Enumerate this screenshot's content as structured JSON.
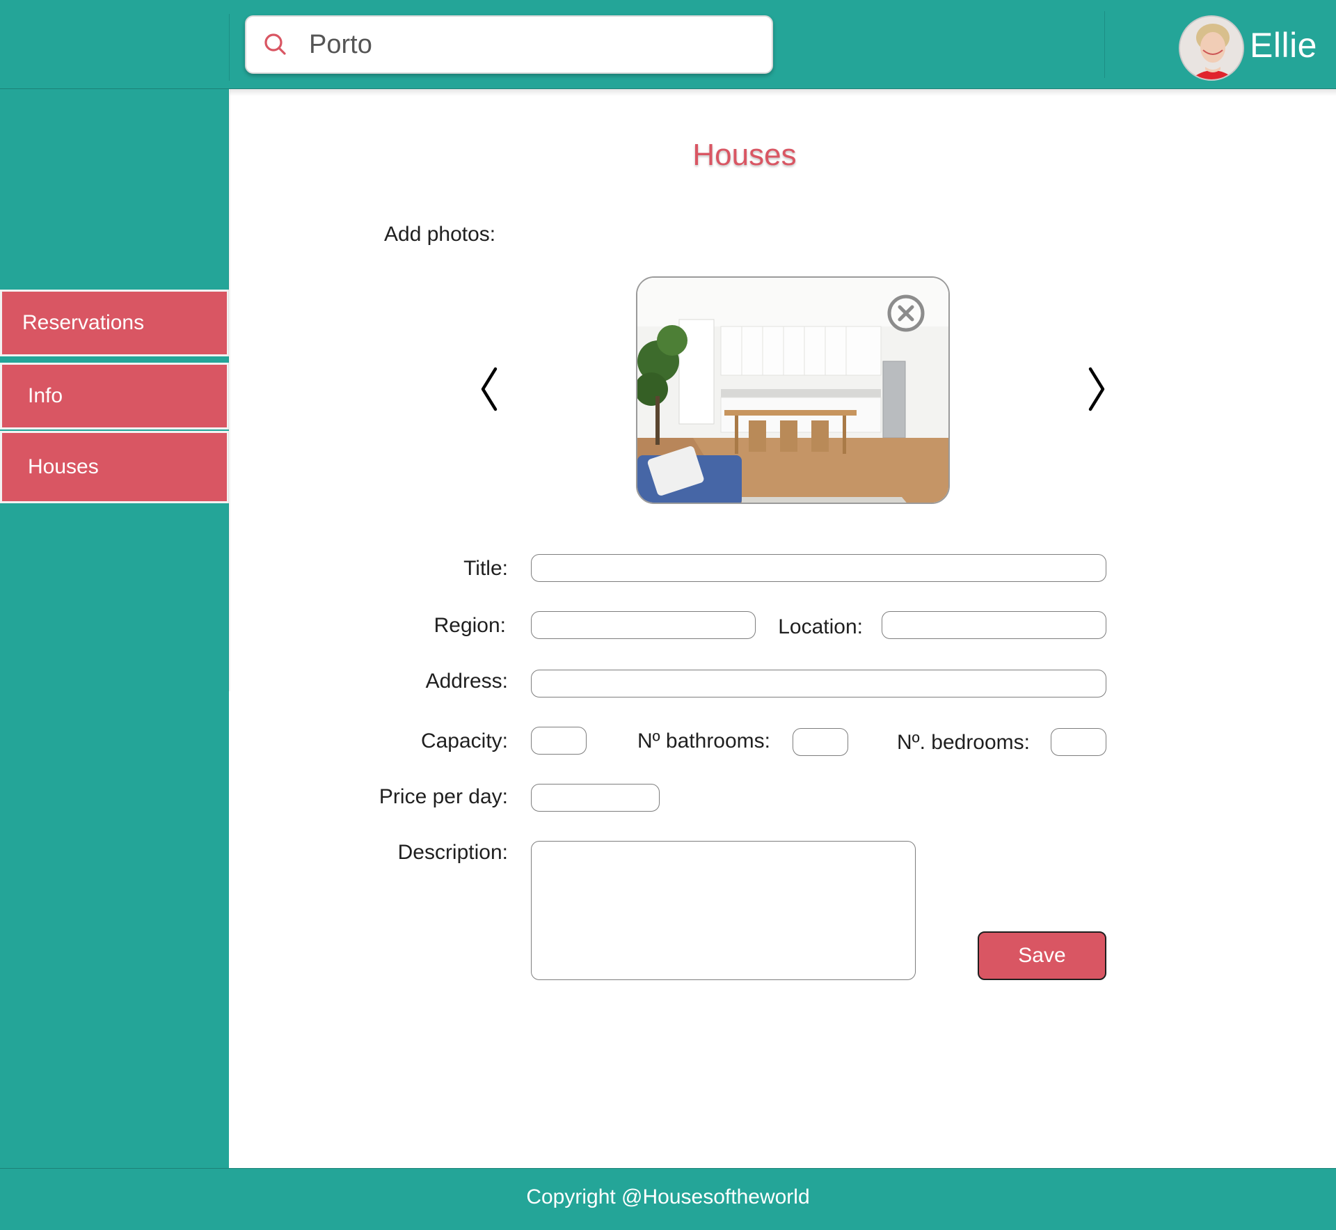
{
  "header": {
    "search": {
      "value": "Porto",
      "icon": "search-icon"
    },
    "user": {
      "name": "Ellie",
      "avatar": "avatar"
    }
  },
  "sidebar": {
    "items": [
      {
        "label": "Reservations"
      },
      {
        "label": "Info"
      },
      {
        "label": "Houses"
      }
    ]
  },
  "main": {
    "title": "Houses",
    "add_photos_label": "Add photos:",
    "carousel": {
      "prev_icon": "chevron-left-icon",
      "next_icon": "chevron-right-icon",
      "remove_icon": "close-circle-icon"
    },
    "form": {
      "title_label": "Title:",
      "region_label": "Region:",
      "location_label": "Location:",
      "address_label": "Address:",
      "capacity_label": "Capacity:",
      "bathrooms_label": "Nº bathrooms:",
      "bedrooms_label": "Nº. bedrooms:",
      "price_label": "Price per day:",
      "description_label": "Description:",
      "save_label": "Save"
    }
  },
  "footer": {
    "text": "Copyright @Housesoftheworld"
  },
  "colors": {
    "teal": "#24a598",
    "accent": "#d95663",
    "white": "#ffffff"
  }
}
